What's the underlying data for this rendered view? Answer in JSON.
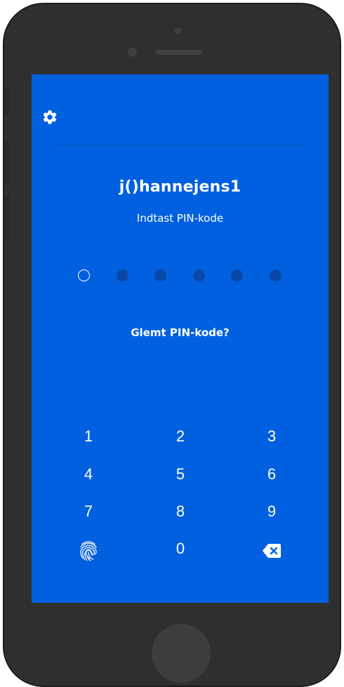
{
  "colors": {
    "screen_bg": "#0060e0",
    "text": "#ffffff",
    "pin_dot_inactive": "#0a48a8",
    "device_body": "#2f2f2f"
  },
  "header": {
    "settings_icon": "gear-icon"
  },
  "account": {
    "username": "j()hannejens1",
    "prompt": "Indtast PIN-kode"
  },
  "pin": {
    "length": 6,
    "entered": 0
  },
  "forgot_pin_label": "Glemt PIN-kode?",
  "keypad": {
    "keys": [
      "1",
      "2",
      "3",
      "4",
      "5",
      "6",
      "7",
      "8",
      "9",
      "0"
    ],
    "biometric_icon": "fingerprint-icon",
    "delete_icon": "backspace-icon"
  }
}
